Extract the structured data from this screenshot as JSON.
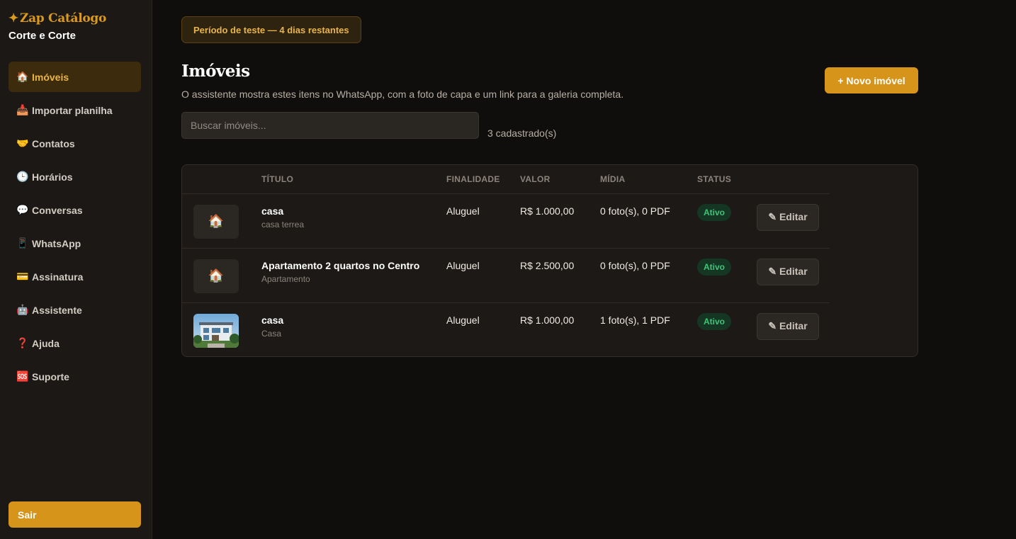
{
  "sidebar": {
    "brand": "Zap Catálogo",
    "brand_star": "✦",
    "company": "Corte e Corte",
    "items": [
      {
        "icon": "🏠",
        "icon_name": "house-icon",
        "label": "Imóveis",
        "active": true
      },
      {
        "icon": "📥",
        "icon_name": "inbox-tray-icon",
        "label": "Importar planilha"
      },
      {
        "icon": "🤝",
        "icon_name": "handshake-icon",
        "label": "Contatos"
      },
      {
        "icon": "🕒",
        "icon_name": "clock-icon",
        "label": "Horários"
      },
      {
        "icon": "💬",
        "icon_name": "speech-bubble-icon",
        "label": "Conversas"
      },
      {
        "icon": "📱",
        "icon_name": "mobile-phone-icon",
        "label": "WhatsApp"
      },
      {
        "icon": "💳",
        "icon_name": "credit-card-icon",
        "label": "Assinatura"
      },
      {
        "icon": "🤖",
        "icon_name": "robot-icon",
        "label": "Assistente"
      },
      {
        "icon": "❓",
        "icon_name": "question-mark-icon",
        "label": "Ajuda"
      },
      {
        "icon": "🆘",
        "icon_name": "sos-icon",
        "label": "Suporte"
      }
    ],
    "logout_label": "Sair"
  },
  "trial_banner": "Período de teste — 4 dias restantes",
  "main": {
    "title": "Imóveis",
    "description": "O assistente mostra estes itens no WhatsApp, com a foto de capa e um link para a galeria completa.",
    "new_button": "+ Novo imóvel",
    "search_placeholder": "Buscar imóveis...",
    "count_text": "3 cadastrado(s)"
  },
  "table": {
    "headers": [
      "",
      "Título",
      "Finalidade",
      "Valor",
      "Mídia",
      "Status",
      ""
    ],
    "rows": [
      {
        "thumb": "🏠",
        "title": "casa",
        "subtitle": "casa terrea",
        "finalidade": "Aluguel",
        "valor": "R$ 1.000,00",
        "midia": "0 foto(s), 0 PDF",
        "status": "Ativo",
        "action": "✎ Editar",
        "has_photo": false
      },
      {
        "thumb": "🏠",
        "title": "Apartamento 2 quartos no Centro",
        "subtitle": "Apartamento",
        "finalidade": "Aluguel",
        "valor": "R$ 2.500,00",
        "midia": "0 foto(s), 0 PDF",
        "status": "Ativo",
        "action": "✎ Editar",
        "has_photo": false
      },
      {
        "thumb": "",
        "title": "casa",
        "subtitle": "Casa",
        "finalidade": "Aluguel",
        "valor": "R$ 1.000,00",
        "midia": "1 foto(s), 1 PDF",
        "status": "Ativo",
        "action": "✎ Editar",
        "has_photo": true
      }
    ]
  },
  "colors": {
    "accent": "#d6951a",
    "background": "#100e0c",
    "sidebar": "#1b1815",
    "status_active": "#3fc57a"
  }
}
